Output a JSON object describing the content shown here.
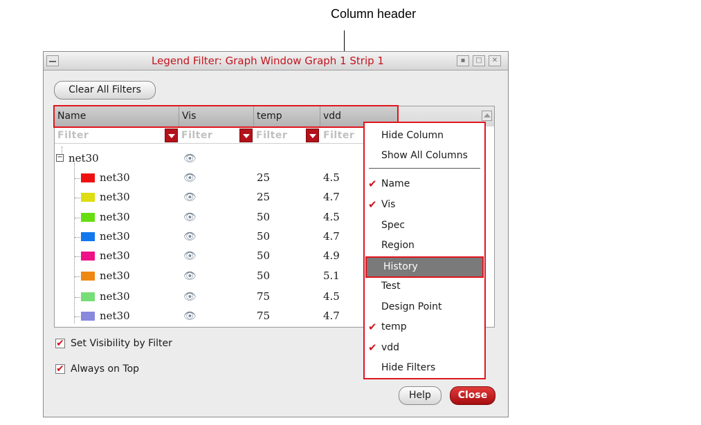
{
  "callout": {
    "label": "Column header"
  },
  "window": {
    "title": "Legend Filter: Graph Window Graph 1 Strip 1",
    "clear_button": "Clear All Filters",
    "help_button": "Help",
    "close_button": "Close"
  },
  "table": {
    "columns": [
      "Name",
      "Vis",
      "temp",
      "vdd"
    ],
    "filter_placeholder": "Filter",
    "group": {
      "name": "net30",
      "expanded": true,
      "visible": true
    },
    "rows": [
      {
        "name": "net30",
        "color": "#ee1111",
        "visible": true,
        "temp": "25",
        "vdd": "4.5"
      },
      {
        "name": "net30",
        "color": "#dddd11",
        "visible": true,
        "temp": "25",
        "vdd": "4.7"
      },
      {
        "name": "net30",
        "color": "#66dd11",
        "visible": true,
        "temp": "50",
        "vdd": "4.5"
      },
      {
        "name": "net30",
        "color": "#1177ee",
        "visible": true,
        "temp": "50",
        "vdd": "4.7"
      },
      {
        "name": "net30",
        "color": "#ee1188",
        "visible": true,
        "temp": "50",
        "vdd": "4.9"
      },
      {
        "name": "net30",
        "color": "#ee8811",
        "visible": true,
        "temp": "50",
        "vdd": "5.1"
      },
      {
        "name": "net30",
        "color": "#77dd77",
        "visible": true,
        "temp": "75",
        "vdd": "4.5"
      },
      {
        "name": "net30",
        "color": "#8888dd",
        "visible": true,
        "temp": "75",
        "vdd": "4.7"
      }
    ]
  },
  "options": {
    "set_visibility": {
      "label": "Set Visibility by Filter",
      "checked": true
    },
    "always_on_top": {
      "label": "Always on Top",
      "checked": true
    }
  },
  "context_menu": {
    "top_items": [
      "Hide Column",
      "Show All Columns"
    ],
    "items": [
      {
        "label": "Name",
        "checked": true
      },
      {
        "label": "Vis",
        "checked": true
      },
      {
        "label": "Spec",
        "checked": false
      },
      {
        "label": "Region",
        "checked": false
      },
      {
        "label": "History",
        "checked": false,
        "highlighted": true
      },
      {
        "label": "Test",
        "checked": false
      },
      {
        "label": "Design Point",
        "checked": false
      },
      {
        "label": "temp",
        "checked": true
      },
      {
        "label": "vdd",
        "checked": true
      },
      {
        "label": "Hide Filters",
        "checked": false
      }
    ]
  },
  "colors": {
    "accent_red": "#e0141e",
    "title_red": "#c4141e"
  }
}
